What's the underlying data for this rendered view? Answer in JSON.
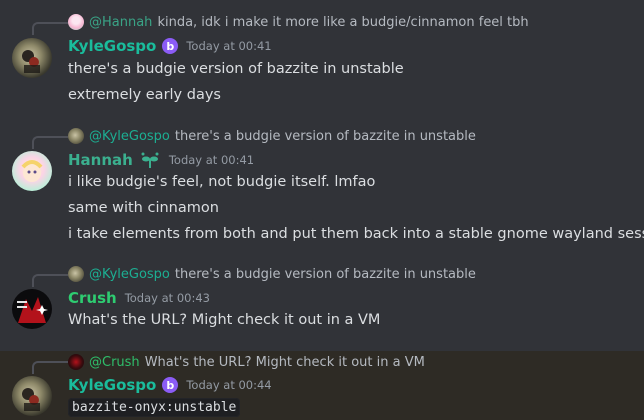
{
  "messages": [
    {
      "reply_mention": "@Hannah",
      "reply_text": "kinda, idk i make it more like a budgie/cinnamon feel tbh",
      "author": "KyleGospo",
      "author_color": "#1abc9c",
      "badge_glyph": "b",
      "timestamp": "Today at 00:41",
      "lines": [
        "there's a budgie version of bazzite in unstable",
        "extremely early days"
      ]
    },
    {
      "reply_mention": "@KyleGospo",
      "reply_text": "there's a budgie version of bazzite in unstable",
      "author": "Hannah",
      "author_color": "#3bb08f",
      "timestamp": "Today at 00:41",
      "lines": [
        "i like budgie's feel, not budgie itself. lmfao",
        "same with cinnamon",
        "i take elements from both and put them back into a stable gnome wayland session"
      ]
    },
    {
      "reply_mention": "@KyleGospo",
      "reply_text": "there's a budgie version of bazzite in unstable",
      "author": "Crush",
      "author_color": "#2ecc71",
      "timestamp": "Today at 00:43",
      "lines": [
        "What's the URL? Might check it out in a VM"
      ]
    },
    {
      "reply_mention": "@Crush",
      "reply_text": "What's the URL? Might check it out in a VM",
      "author": "KyleGospo",
      "author_color": "#1abc9c",
      "badge_glyph": "b",
      "timestamp": "Today at 00:44",
      "code": "bazzite-onyx:unstable"
    }
  ],
  "colors": {
    "background": "#313338",
    "highlight": "#2e2b25",
    "badge": "#8b5cf6",
    "mention": "#a5b4fc"
  }
}
